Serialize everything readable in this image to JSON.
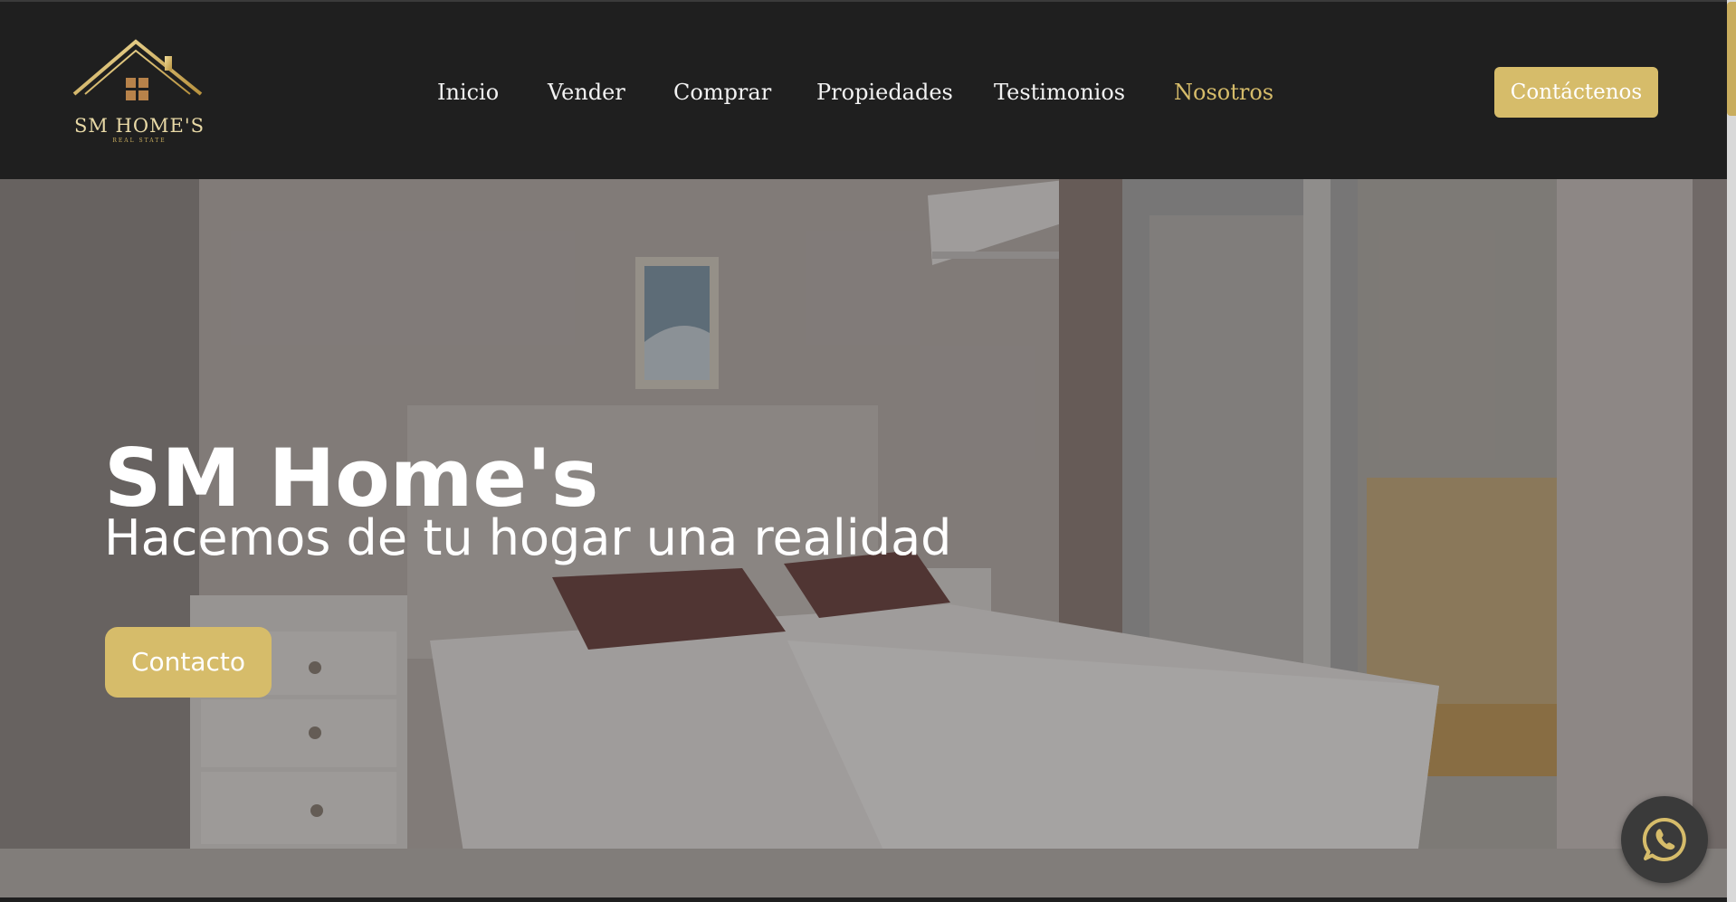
{
  "brand": {
    "name": "SM HOME'S",
    "tagline": "REAL STATE"
  },
  "nav": {
    "items": [
      {
        "label": "Inicio"
      },
      {
        "label": "Vender"
      },
      {
        "label": "Comprar"
      },
      {
        "label": "Propiedades"
      },
      {
        "label": "Testimonios"
      },
      {
        "label": "Nosotros",
        "active": true
      }
    ],
    "cta_label": "Contáctenos"
  },
  "hero": {
    "title": "SM Home's",
    "subtitle": "Hacemos de tu hogar una realidad",
    "button_label": "Contacto"
  },
  "floating": {
    "icon": "whatsapp-icon"
  },
  "colors": {
    "accent": "#d6bc6a",
    "header_bg": "#1f1f1f",
    "active_nav": "#d6bc6a"
  }
}
